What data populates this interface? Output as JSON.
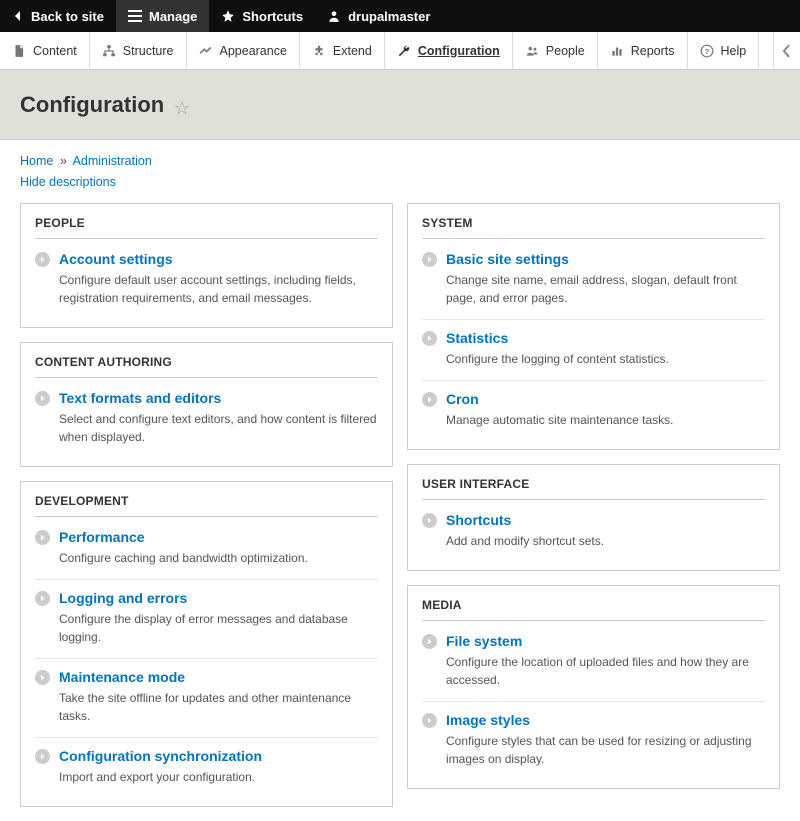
{
  "topbar": {
    "back": "Back to site",
    "manage": "Manage",
    "shortcuts": "Shortcuts",
    "user": "drupalmaster"
  },
  "adminbar": {
    "content": "Content",
    "structure": "Structure",
    "appearance": "Appearance",
    "extend": "Extend",
    "configuration": "Configuration",
    "people": "People",
    "reports": "Reports",
    "help": "Help"
  },
  "page": {
    "title": "Configuration",
    "breadcrumb_home": "Home",
    "breadcrumb_admin": "Administration",
    "hide_desc": "Hide descriptions"
  },
  "left": [
    {
      "title": "PEOPLE",
      "items": [
        {
          "label": "Account settings",
          "desc": "Configure default user account settings, including fields, registration requirements, and email messages."
        }
      ]
    },
    {
      "title": "CONTENT AUTHORING",
      "items": [
        {
          "label": "Text formats and editors",
          "desc": "Select and configure text editors, and how content is filtered when displayed."
        }
      ]
    },
    {
      "title": "DEVELOPMENT",
      "items": [
        {
          "label": "Performance",
          "desc": "Configure caching and bandwidth optimization."
        },
        {
          "label": "Logging and errors",
          "desc": "Configure the display of error messages and database logging."
        },
        {
          "label": "Maintenance mode",
          "desc": "Take the site offline for updates and other maintenance tasks."
        },
        {
          "label": "Configuration synchronization",
          "desc": "Import and export your configuration."
        }
      ]
    }
  ],
  "right": [
    {
      "title": "SYSTEM",
      "items": [
        {
          "label": "Basic site settings",
          "desc": "Change site name, email address, slogan, default front page, and error pages."
        },
        {
          "label": "Statistics",
          "desc": "Configure the logging of content statistics."
        },
        {
          "label": "Cron",
          "desc": "Manage automatic site maintenance tasks."
        }
      ]
    },
    {
      "title": "USER INTERFACE",
      "items": [
        {
          "label": "Shortcuts",
          "desc": "Add and modify shortcut sets."
        }
      ]
    },
    {
      "title": "MEDIA",
      "items": [
        {
          "label": "File system",
          "desc": "Configure the location of uploaded files and how they are accessed."
        },
        {
          "label": "Image styles",
          "desc": "Configure styles that can be used for resizing or adjusting images on display."
        }
      ]
    }
  ]
}
